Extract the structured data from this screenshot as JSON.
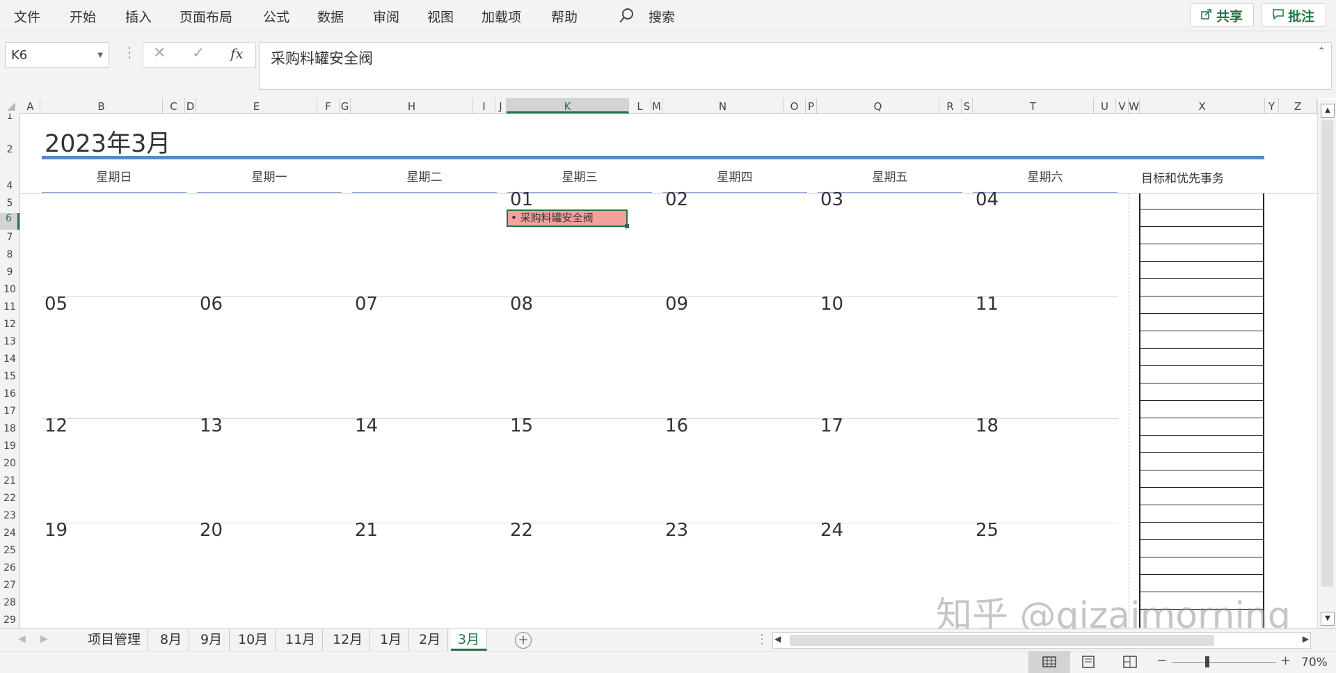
{
  "ribbon": {
    "tabs": [
      "文件",
      "开始",
      "插入",
      "页面布局",
      "公式",
      "数据",
      "审阅",
      "视图",
      "加载项",
      "帮助"
    ],
    "search_label": "搜索",
    "share_label": "共享",
    "comment_label": "批注"
  },
  "formula_bar": {
    "name_box": "K6",
    "fx_label": "fx",
    "content": "采购料罐安全阀"
  },
  "columns": [
    "A",
    "B",
    "C",
    "D",
    "E",
    "F",
    "G",
    "H",
    "I",
    "J",
    "K",
    "L",
    "M",
    "N",
    "O",
    "P",
    "Q",
    "R",
    "S",
    "T",
    "U",
    "V",
    "W",
    "X",
    "Y",
    "Z"
  ],
  "rows": [
    "1",
    "2",
    "4",
    "5",
    "6",
    "7",
    "8",
    "9",
    "10",
    "11",
    "12",
    "13",
    "14",
    "15",
    "16",
    "17",
    "18",
    "19",
    "20",
    "21",
    "22",
    "23",
    "24",
    "25",
    "26",
    "27",
    "28",
    "29"
  ],
  "calendar": {
    "title": "2023年3月",
    "weekdays": [
      "星期日",
      "星期一",
      "星期二",
      "星期三",
      "星期四",
      "星期五",
      "星期六"
    ],
    "goals_header": "目标和优先事务",
    "weeks": [
      [
        "",
        "",
        "",
        "01",
        "02",
        "03",
        "04"
      ],
      [
        "05",
        "06",
        "07",
        "08",
        "09",
        "10",
        "11"
      ],
      [
        "12",
        "13",
        "14",
        "15",
        "16",
        "17",
        "18"
      ],
      [
        "19",
        "20",
        "21",
        "22",
        "23",
        "24",
        "25"
      ]
    ],
    "event_text": "• 采购料罐安全阀"
  },
  "sheet_tabs": [
    "项目管理",
    "8月",
    "9月",
    "10月",
    "11月",
    "12月",
    "1月",
    "2月",
    "3月"
  ],
  "active_sheet": "3月",
  "status": {
    "zoom": "70%"
  },
  "watermark": "知乎 @qizaimorning",
  "colors": {
    "accent": "#217346",
    "title_rule": "#5b8ac6",
    "event_fill": "#f4a09c"
  }
}
